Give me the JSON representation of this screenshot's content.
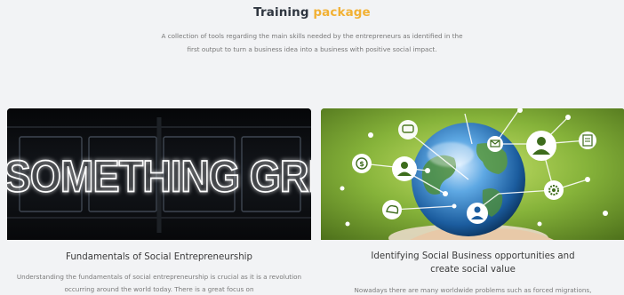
{
  "header": {
    "title_main": "Training",
    "title_accent": "package",
    "intro": "A collection of tools regarding the main skills needed by the entrepreneurs as identified in the first output to turn a business idea into a business with positive social impact."
  },
  "cards": [
    {
      "image_text": "DO SOMETHING GREAT",
      "title": "Fundamentals of Social Entrepreneurship",
      "description": "Understanding the fundamentals of social entrepreneurship is crucial as it is a revolution occurring around the world today. There is a great focus on"
    },
    {
      "image_icons": [
        "chat-icon",
        "money-icon",
        "mail-icon",
        "user-icon",
        "ai-icon",
        "document-icon",
        "gear-icon"
      ],
      "title": "Identifying Social Business opportunities and create social value",
      "description": "Nowadays there are many worldwide problems such as forced migrations,"
    }
  ],
  "colors": {
    "accent": "#f2b134",
    "background": "#f2f3f5",
    "title_text": "#2f3640"
  }
}
